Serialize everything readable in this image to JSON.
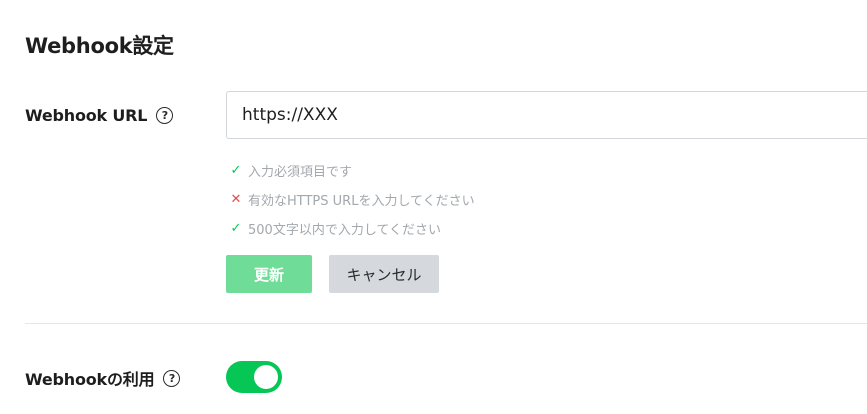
{
  "section": {
    "title": "Webhook設定"
  },
  "webhook_url": {
    "label": "Webhook URL",
    "help_icon": "?",
    "value": "https://XXX",
    "validations": [
      {
        "status": "ok",
        "icon": "check-icon",
        "mark": "✓",
        "text": "入力必須項目です"
      },
      {
        "status": "error",
        "icon": "cross-icon",
        "mark": "✕",
        "text": "有効なHTTPS URLを入力してください"
      },
      {
        "status": "ok",
        "icon": "check-icon",
        "mark": "✓",
        "text": "500文字以内で入力してください"
      }
    ],
    "buttons": {
      "update_label": "更新",
      "cancel_label": "キャンセル"
    }
  },
  "webhook_use": {
    "label": "Webhookの利用",
    "help_icon": "?",
    "enabled": true
  },
  "colors": {
    "accent": "#06c755",
    "error": "#e64c4c",
    "update_button": "#6fdc98",
    "cancel_button": "#d5d8dc",
    "hint_text": "#a3a8ad"
  }
}
